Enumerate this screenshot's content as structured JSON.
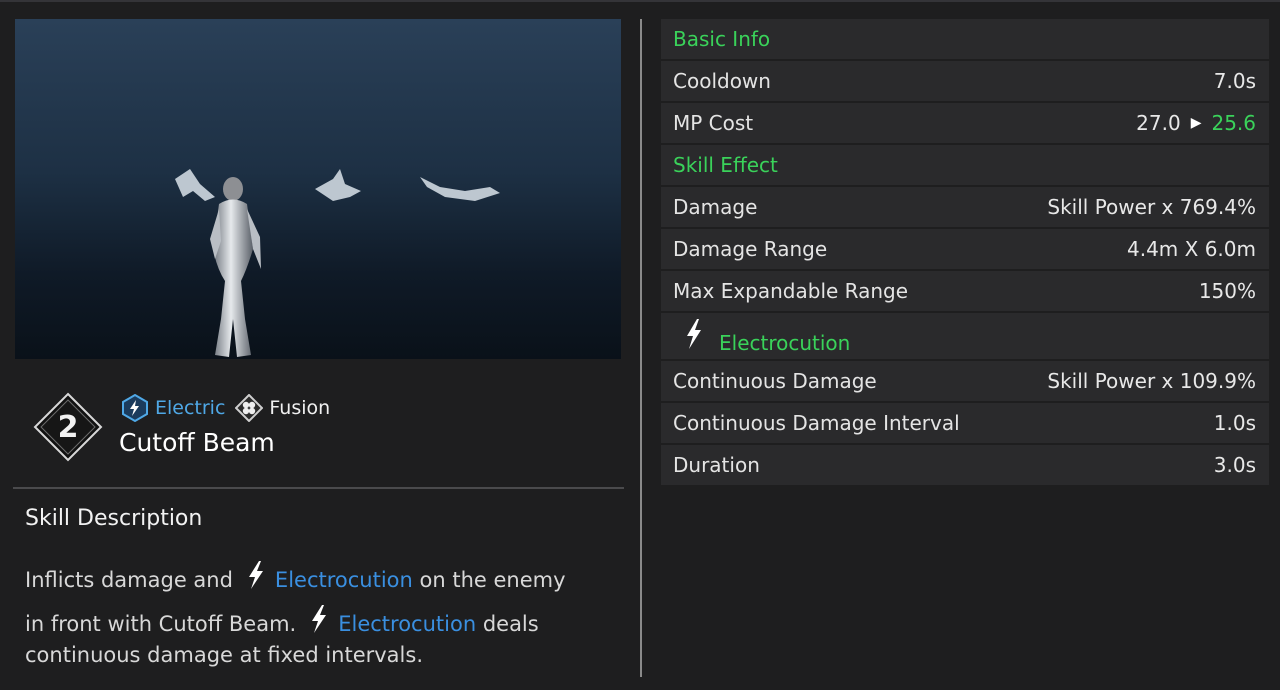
{
  "skill": {
    "slot": "2",
    "element": "Electric",
    "type": "Fusion",
    "name": "Cutoff Beam"
  },
  "description": {
    "title": "Skill Description",
    "line1_pre": "Inflicts damage and",
    "line1_kw": "Electrocution",
    "line1_post": "on the enemy",
    "line2_pre": "in front with Cutoff Beam.",
    "line2_kw": "Electrocution",
    "line2_post": "deals",
    "line3": "continuous damage at fixed intervals."
  },
  "stats": {
    "basic_info": "Basic Info",
    "cooldown_label": "Cooldown",
    "cooldown_value": "7.0s",
    "mp_label": "MP Cost",
    "mp_old": "27.0",
    "mp_new": "25.6",
    "skill_effect": "Skill Effect",
    "damage_label": "Damage",
    "damage_value": "Skill Power x 769.4%",
    "range_label": "Damage Range",
    "range_value": "4.4m X 6.0m",
    "max_range_label": "Max Expandable Range",
    "max_range_value": "150%",
    "electrocution": "Electrocution",
    "cont_damage_label": "Continuous Damage",
    "cont_damage_value": "Skill Power x 109.9%",
    "interval_label": "Continuous Damage Interval",
    "interval_value": "1.0s",
    "duration_label": "Duration",
    "duration_value": "3.0s"
  },
  "colors": {
    "accent_green": "#3ad25a",
    "keyword_blue": "#3a8fe0",
    "element_blue": "#4fa8e6"
  },
  "icons": [
    "diamond-slot-icon",
    "electric-icon",
    "fusion-icon",
    "lightning-bolt-icon",
    "arrow-right-icon"
  ]
}
